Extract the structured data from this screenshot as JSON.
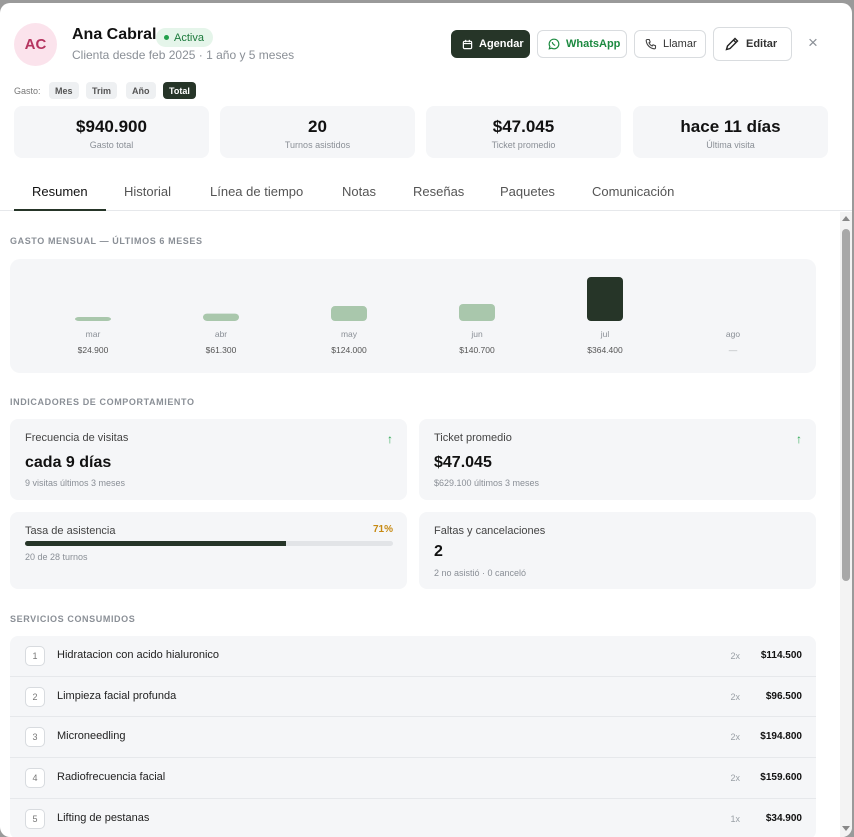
{
  "client": {
    "initials": "AC",
    "name": "Ana Cabral",
    "status": "Activa",
    "since": "Clienta desde feb 2025 · 1 año y 5 meses"
  },
  "actions": {
    "agendar": "Agendar",
    "whatsapp": "WhatsApp",
    "llamar": "Llamar",
    "editar": "Editar",
    "close": "×"
  },
  "gasto_filter": {
    "label": "Gasto:",
    "options": [
      "Mes",
      "Trim",
      "Año",
      "Total"
    ],
    "selected": "Total"
  },
  "kpis": [
    {
      "value": "$940.900",
      "label": "Gasto total"
    },
    {
      "value": "20",
      "label": "Turnos asistidos"
    },
    {
      "value": "$47.045",
      "label": "Ticket promedio"
    },
    {
      "value": "hace 11 días",
      "label": "Última visita"
    }
  ],
  "tabs": [
    "Resumen",
    "Historial",
    "Línea de tiempo",
    "Notas",
    "Reseñas",
    "Paquetes",
    "Comunicación"
  ],
  "active_tab": "Resumen",
  "sections": {
    "gasto": "GASTO MENSUAL — ÚLTIMOS 6 MESES",
    "indicadores": "INDICADORES DE COMPORTAMIENTO",
    "servicios": "SERVICIOS CONSUMIDOS"
  },
  "chart_data": {
    "type": "bar",
    "title": "GASTO MENSUAL — ÚLTIMOS 6 MESES",
    "categories": [
      "mar",
      "abr",
      "may",
      "jun",
      "jul",
      "ago"
    ],
    "values": [
      24900,
      61300,
      124000,
      140700,
      364400,
      null
    ],
    "value_labels": [
      "$24.900",
      "$61.300",
      "$124.000",
      "$140.700",
      "$364.400",
      "—"
    ],
    "highlight_index": 4,
    "colors": {
      "bar": "#a9c7ac",
      "highlight": "#263528"
    },
    "grid": false
  },
  "indicators": {
    "frecuencia": {
      "title": "Frecuencia de visitas",
      "value": "cada 9 días",
      "sub": "9 visitas últimos 3 meses",
      "trend": "up"
    },
    "ticket": {
      "title": "Ticket promedio",
      "value": "$47.045",
      "sub": "$629.100 últimos 3 meses",
      "trend": "up"
    },
    "asistencia": {
      "title": "Tasa de asistencia",
      "percent_label": "71%",
      "percent": 71,
      "sub": "20 de 28 turnos"
    },
    "faltas": {
      "title": "Faltas y cancelaciones",
      "value": "2",
      "sub": "2 no asistió · 0 canceló"
    }
  },
  "services": [
    {
      "n": "1",
      "name": "Hidratacion con acido hialuronico",
      "qty": "2x",
      "price": "$114.500"
    },
    {
      "n": "2",
      "name": "Limpieza facial profunda",
      "qty": "2x",
      "price": "$96.500"
    },
    {
      "n": "3",
      "name": "Microneedling",
      "qty": "2x",
      "price": "$194.800"
    },
    {
      "n": "4",
      "name": "Radiofrecuencia facial",
      "qty": "2x",
      "price": "$159.600"
    },
    {
      "n": "5",
      "name": "Lifting de pestanas",
      "qty": "1x",
      "price": "$34.900"
    }
  ],
  "colors": {
    "accent": "#263528",
    "success": "#2aa852",
    "warning": "#c78a12",
    "avatar_bg": "#fbe3ec",
    "avatar_fg": "#b5345f"
  }
}
